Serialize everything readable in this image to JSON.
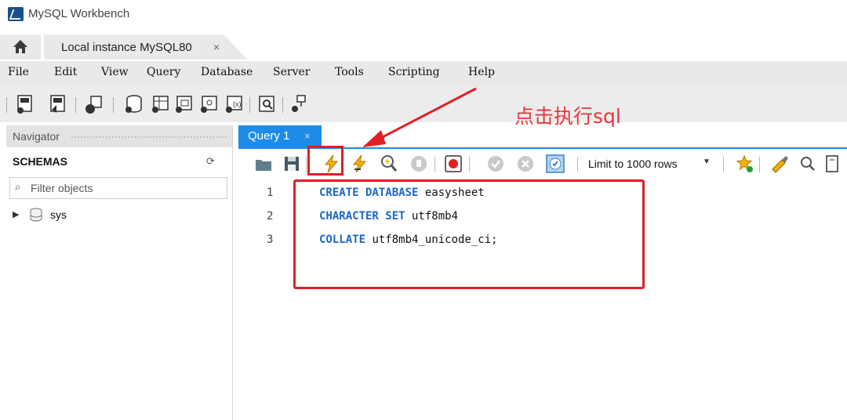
{
  "window": {
    "title": "MySQL Workbench"
  },
  "tabs": {
    "home_icon": "home-icon",
    "instance": "Local instance MySQL80",
    "close_glyph": "×"
  },
  "menu": [
    {
      "label": "File"
    },
    {
      "label": "Edit"
    },
    {
      "label": "View"
    },
    {
      "label": "Query"
    },
    {
      "label": "Database"
    },
    {
      "label": "Server"
    },
    {
      "label": "Tools"
    },
    {
      "label": "Scripting"
    },
    {
      "label": "Help"
    }
  ],
  "toolbar_icons": [
    "new-sql-tab-icon",
    "open-sql-script-icon",
    "inspector-icon",
    "create-schema-icon",
    "create-table-icon",
    "create-view-icon",
    "create-procedure-icon",
    "create-function-icon",
    "search-table-data-icon",
    "reconnect-icon"
  ],
  "navigator": {
    "header": "Navigator",
    "schemas_label": "SCHEMAS",
    "filter_placeholder": "Filter objects",
    "schemas": [
      {
        "name": "sys"
      }
    ]
  },
  "query": {
    "tab_label": "Query 1",
    "tab_close": "×",
    "limit_label": "Limit to 1000 rows",
    "toolbar_icons": [
      "open-file-icon",
      "save-icon",
      "execute-icon",
      "execute-current-statement-icon",
      "explain-icon",
      "stop-icon",
      "toggle-continue-on-error-icon",
      "commit-icon",
      "rollback-icon",
      "autocommit-icon",
      "limit-dropdown",
      "add-snippet-icon",
      "beautify-icon",
      "find-icon",
      "wrap-icon"
    ]
  },
  "editor": {
    "lines": [
      {
        "num": "1",
        "keyword": "CREATE DATABASE",
        "rest": " easysheet"
      },
      {
        "num": "2",
        "keyword": "CHARACTER SET",
        "rest": " utf8mb4"
      },
      {
        "num": "3",
        "keyword": "COLLATE",
        "rest": " utf8mb4_unicode_ci;"
      }
    ]
  },
  "annotation": {
    "text": "点击执行sql",
    "color": "#e01f26"
  },
  "colors": {
    "accent": "#1c8ce8",
    "keyword": "#1a67c7",
    "menubar": "#e9e9e9"
  }
}
